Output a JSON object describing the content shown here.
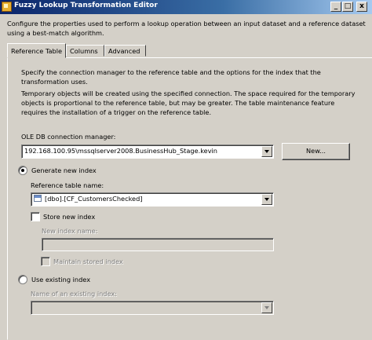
{
  "window": {
    "title": "Fuzzy Lookup Transformation Editor",
    "controls": {
      "minimize": "_",
      "maximize": "□",
      "close": "x"
    }
  },
  "description": "Configure the properties used to perform a lookup operation between an input dataset and a reference dataset using a best-match algorithm.",
  "tabs": [
    {
      "label": "Reference Table",
      "active": true
    },
    {
      "label": "Columns",
      "active": false
    },
    {
      "label": "Advanced",
      "active": false
    }
  ],
  "reference_tab": {
    "intro": "Specify the connection manager to the reference table and the options for the index that the transformation uses.",
    "note": "Temporary objects will be created using the specified connection. The space required for the temporary objects is proportional to the reference table, but may be greater. The table maintenance feature requires the installation of a trigger on the reference table.",
    "connection_label": "OLE DB connection manager:",
    "connection_value": "192.168.100.95\\mssqlserver2008.BusinessHub_Stage.kevin",
    "new_button": "New...",
    "generate_new_index": {
      "label": "Generate new index",
      "selected": true
    },
    "reference_table_label": "Reference table name:",
    "reference_table_value": "[dbo].[CF_CustomersChecked]",
    "store_new_index": {
      "label": "Store new index",
      "checked": false
    },
    "new_index_name_label": "New index name:",
    "new_index_name_value": "",
    "maintain_stored_index": {
      "label": "Maintain stored index",
      "checked": false
    },
    "use_existing_index": {
      "label": "Use existing index",
      "selected": false
    },
    "existing_index_label": "Name of an existing index:",
    "existing_index_value": ""
  }
}
